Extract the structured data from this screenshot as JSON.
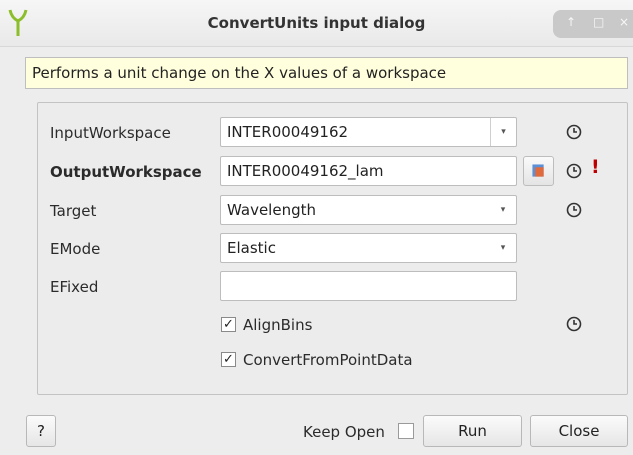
{
  "window": {
    "title": "ConvertUnits input dialog",
    "controls": [
      "↑",
      "□",
      "×"
    ]
  },
  "description": "Performs a unit change on the X values of a workspace",
  "properties": {
    "input_workspace": {
      "label": "InputWorkspace",
      "value": "INTER00049162"
    },
    "output_workspace": {
      "label": "OutputWorkspace",
      "value": "INTER00049162_lam",
      "error_marker": "!"
    },
    "target": {
      "label": "Target",
      "value": "Wavelength"
    },
    "emode": {
      "label": "EMode",
      "value": "Elastic"
    },
    "efixed": {
      "label": "EFixed",
      "value": ""
    },
    "align_bins": {
      "label": "AlignBins",
      "checked": true
    },
    "convert_from_point_data": {
      "label": "ConvertFromPointData",
      "checked": true
    }
  },
  "footer": {
    "help_label": "?",
    "keep_open_label": "Keep Open",
    "keep_open_checked": false,
    "run_label": "Run",
    "close_label": "Close"
  },
  "glyphs": {
    "check": "✓",
    "combo_arrow": "▾"
  },
  "colors": {
    "description_bg": "#ffffdd",
    "error": "#c00000",
    "app_icon": "#8cbd2a"
  }
}
